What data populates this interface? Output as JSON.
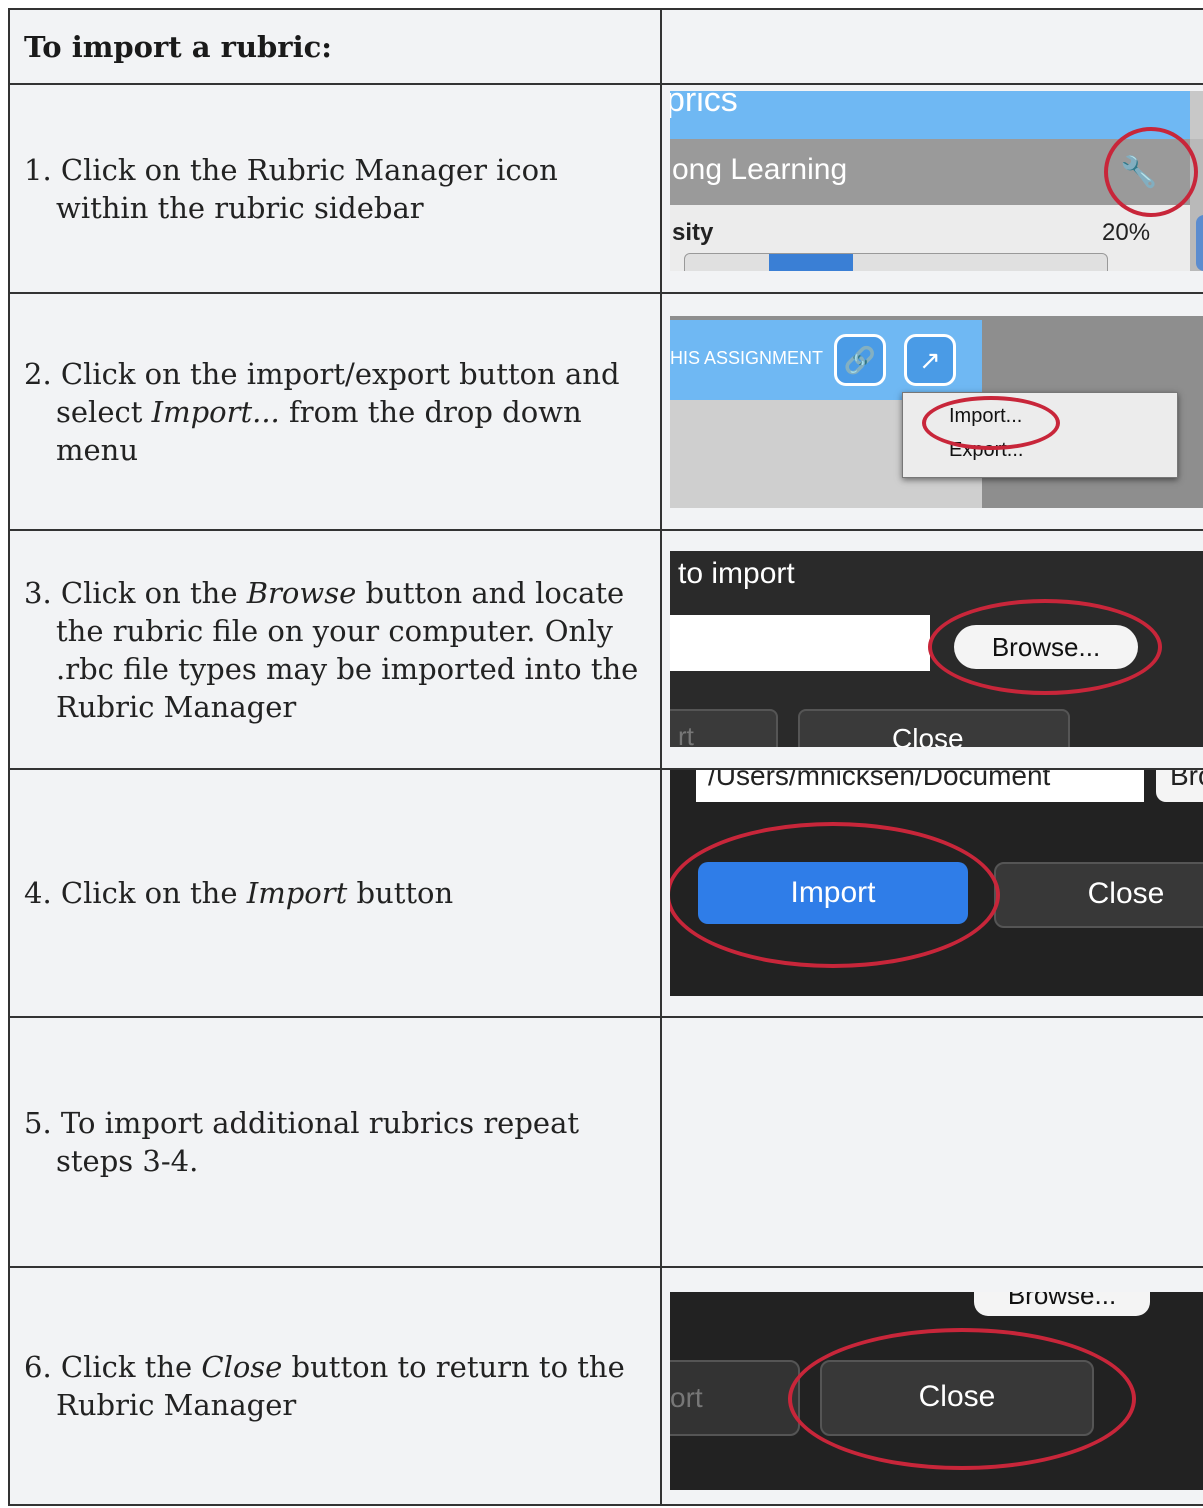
{
  "header": {
    "title": "To import a rubric:"
  },
  "steps": [
    {
      "n": "1.",
      "text": "Click on the Rubric Manager icon within the rubric sidebar"
    },
    {
      "n": "2.",
      "pre": "Click on the import/export button and select ",
      "em": "Import...",
      "post": " from the drop down menu"
    },
    {
      "n": "3.",
      "pre": "Click on the ",
      "em": "Browse",
      "post": " button and locate the rubric file on your computer. Only .rbc file types may be imported into the Rubric Manager"
    },
    {
      "n": "4.",
      "pre": "Click on the ",
      "em": "Import",
      "post": " button"
    },
    {
      "n": "5.",
      "text": "To import additional rubrics repeat steps 3-4."
    },
    {
      "n": "6.",
      "pre": "Click the ",
      "em": "Close",
      "post": " button to return to the Rubric Manager"
    }
  ],
  "shot1": {
    "header": "prics",
    "row": "ong Learning",
    "label": "sity",
    "percent": "20%",
    "icon": "wrench-icon"
  },
  "shot2": {
    "banner": "HIS ASSIGNMENT",
    "menu": [
      "Import...",
      "Export..."
    ],
    "icons": [
      "link-icon",
      "share-icon"
    ]
  },
  "shot3": {
    "title": "to import",
    "browse": "Browse...",
    "close": "Close",
    "partial": "rt"
  },
  "shot4": {
    "path": "/Users/mnicksen/Document",
    "partial": "Bro",
    "import": "Import",
    "close": "Close"
  },
  "shot6": {
    "browse": "Browse...",
    "close": "Close",
    "partial": "ort"
  },
  "colors": {
    "accent": "#c8263a",
    "border": "#333333",
    "cell": "#f2f3f5"
  }
}
